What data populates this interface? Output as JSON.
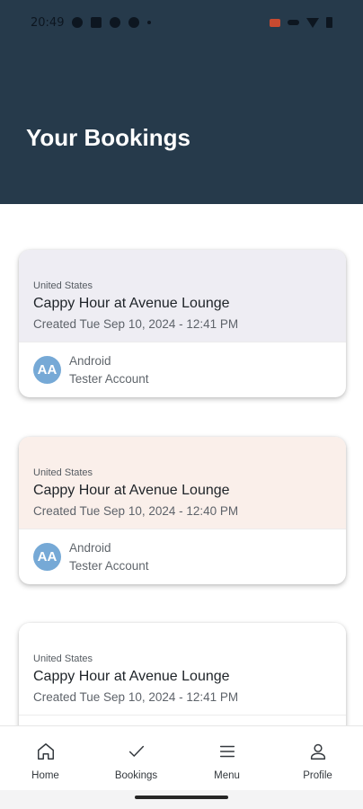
{
  "status_bar": {
    "time": "20:49"
  },
  "header": {
    "title": "Your Bookings"
  },
  "bookings": [
    {
      "country": "United States",
      "title": "Cappy Hour at Avenue Lounge",
      "created": "Created Tue Sep 10, 2024 - 12:41 PM",
      "avatar_initials": "AA",
      "user_first": "Android",
      "user_last": "Tester Account",
      "bg_color": "#eeedf3"
    },
    {
      "country": "United States",
      "title": "Cappy Hour at Avenue Lounge",
      "created": "Created Tue Sep 10, 2024 - 12:40 PM",
      "avatar_initials": "AA",
      "user_first": "Android",
      "user_last": "Tester Account",
      "bg_color": "#faefea"
    },
    {
      "country": "United States",
      "title": "Cappy Hour at Avenue Lounge",
      "created": "Created Tue Sep 10, 2024 - 12:41 PM",
      "bg_color": "#ffffff"
    }
  ],
  "nav": {
    "items": [
      {
        "label": "Home",
        "icon": "home-icon"
      },
      {
        "label": "Bookings",
        "icon": "check-icon"
      },
      {
        "label": "Menu",
        "icon": "menu-icon"
      },
      {
        "label": "Profile",
        "icon": "profile-icon"
      }
    ]
  },
  "colors": {
    "header_bg": "#263a4b",
    "avatar_bg": "#76a9d6"
  }
}
